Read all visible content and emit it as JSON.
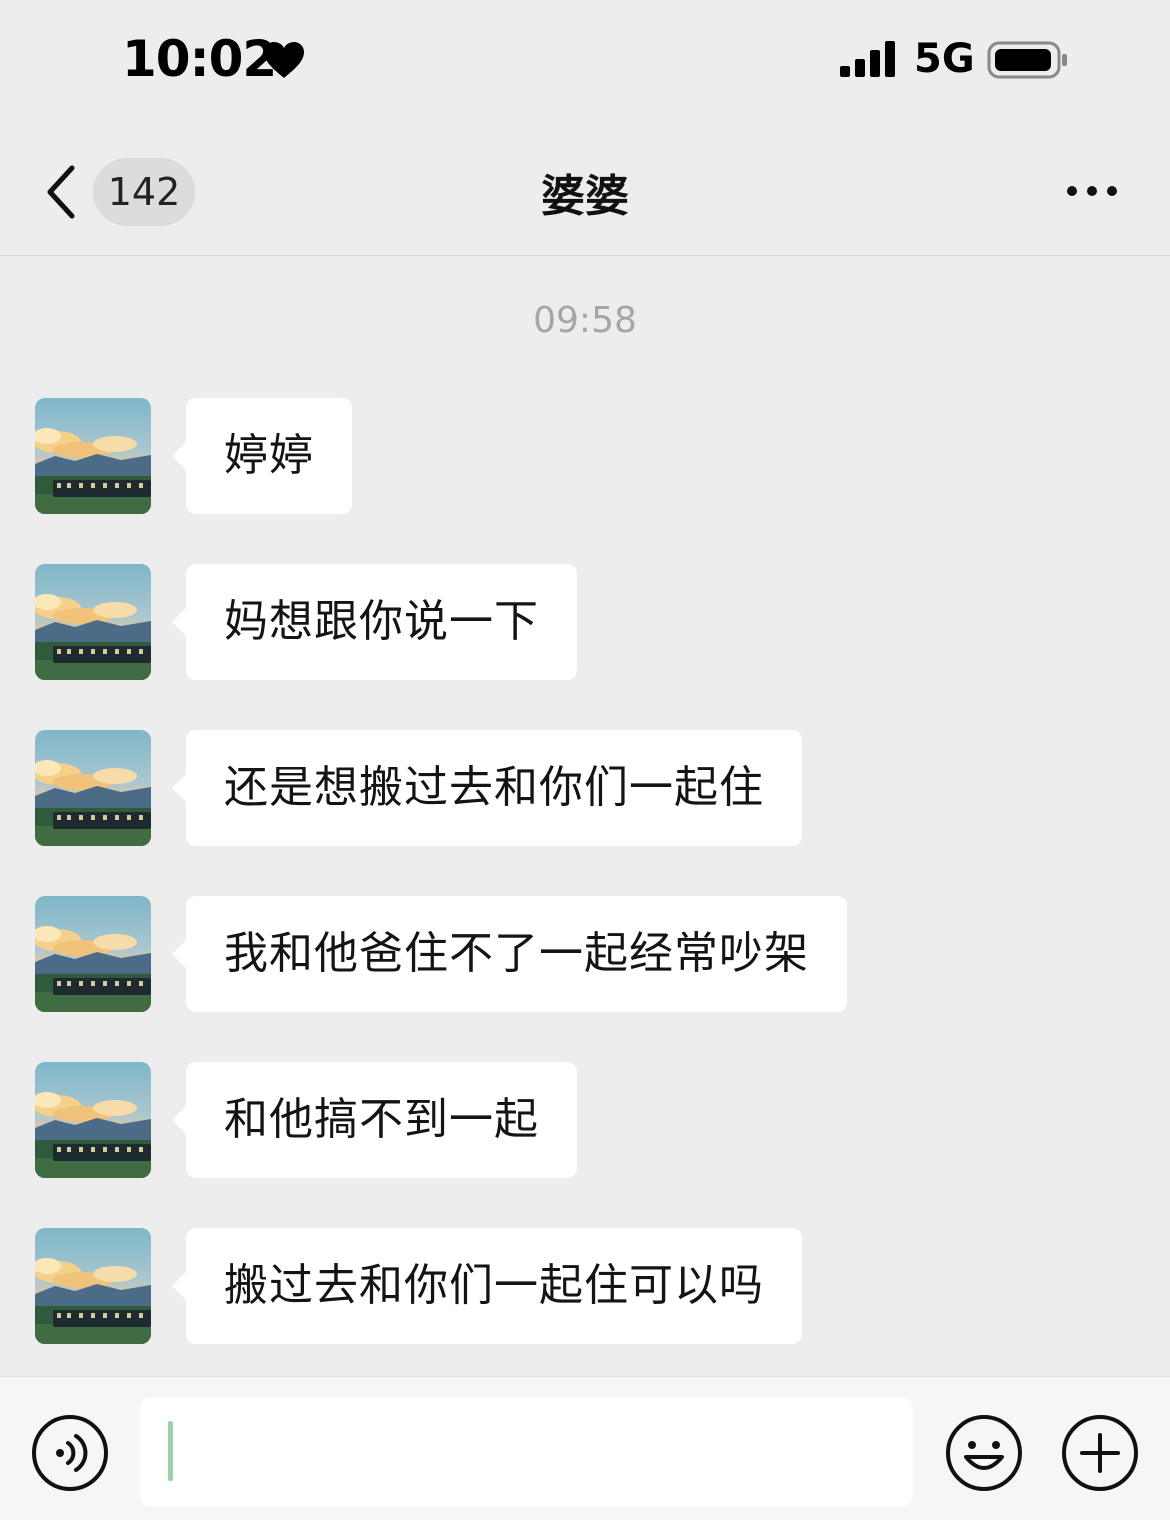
{
  "status_bar": {
    "time": "10:02",
    "network": "5G",
    "icons": [
      "heart-icon",
      "signal-icon",
      "battery-icon"
    ]
  },
  "nav": {
    "unread_count": "142",
    "title": "婆婆",
    "icons": [
      "back-chevron-icon",
      "more-dots-icon"
    ]
  },
  "chat": {
    "timestamp": "09:58",
    "messages": [
      {
        "text": "婷婷"
      },
      {
        "text": "妈想跟你说一下"
      },
      {
        "text": "还是想搬过去和你们一起住"
      },
      {
        "text": "我和他爸住不了一起经常吵架"
      },
      {
        "text": "和他搞不到一起"
      },
      {
        "text": "搬过去和你们一起住可以吗"
      }
    ]
  },
  "input_bar": {
    "text_value": "",
    "icons": [
      "voice-icon",
      "emoji-icon",
      "plus-icon"
    ]
  },
  "colors": {
    "background": "#ededed",
    "bubble": "#ffffff",
    "cursor": "#9bd3a8"
  }
}
